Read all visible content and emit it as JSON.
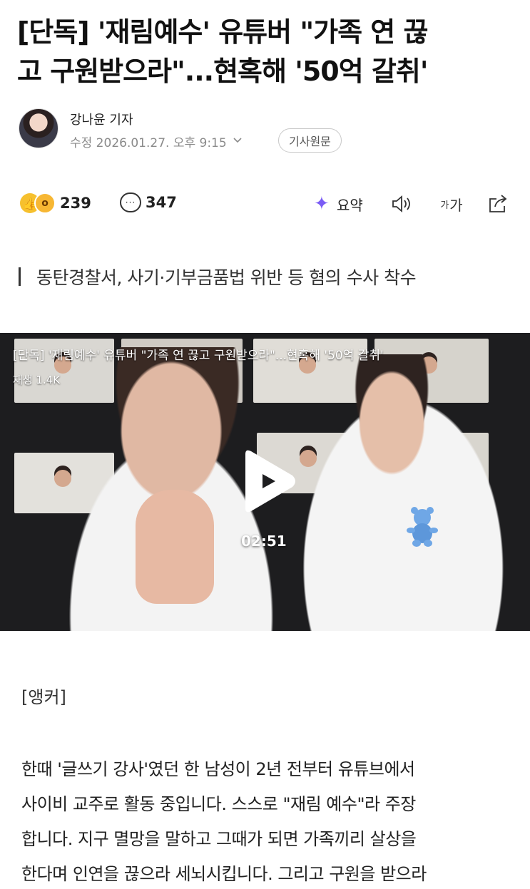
{
  "article": {
    "headline_line1": "[단독] '재림예수' 유튜버 \"가족 연 끊",
    "headline_line2": "고 구원받으라\"...현혹해 '50억 갈취'",
    "reporter": "강나윤 기자",
    "edited_label": "수정 2026.01.27. 오후 9:15",
    "origin_button": "기사원문",
    "subheadline": "동탄경찰서, 사기·기부금품법 위반 등 혐의 수사 착수"
  },
  "actions": {
    "reaction_count": "239",
    "comment_count": "347",
    "summary_label": "요약",
    "font_small": "가",
    "font_large": "가",
    "icons": [
      "thumbs-up-icon",
      "wow-icon",
      "comment-icon",
      "sparkle-icon",
      "speaker-icon",
      "share-icon"
    ]
  },
  "video": {
    "title": "[단독] '재림예수' 유튜버 \"가족 연 끊고 구원받으라\"...현혹해 '50억 갈취'",
    "views": "재생 1.4K",
    "duration": "02:51"
  },
  "body": {
    "anchor_label": "[앵커]",
    "lines": [
      "한때 '글쓰기 강사'였던 한 남성이 2년 전부터 유튜브에서",
      "사이비 교주로 활동 중입니다. 스스로 \"재림 예수\"라 주장",
      "합니다. 지구 멸망을 말하고 그때가 되면 가족끼리 살상을",
      "한다며 인연을 끊으라 세뇌시킵니다. 그리고 구원을 받으라"
    ]
  },
  "colors": {
    "summary_accent": "#7a5cf5",
    "reaction_yellow": "#f6c02e"
  }
}
